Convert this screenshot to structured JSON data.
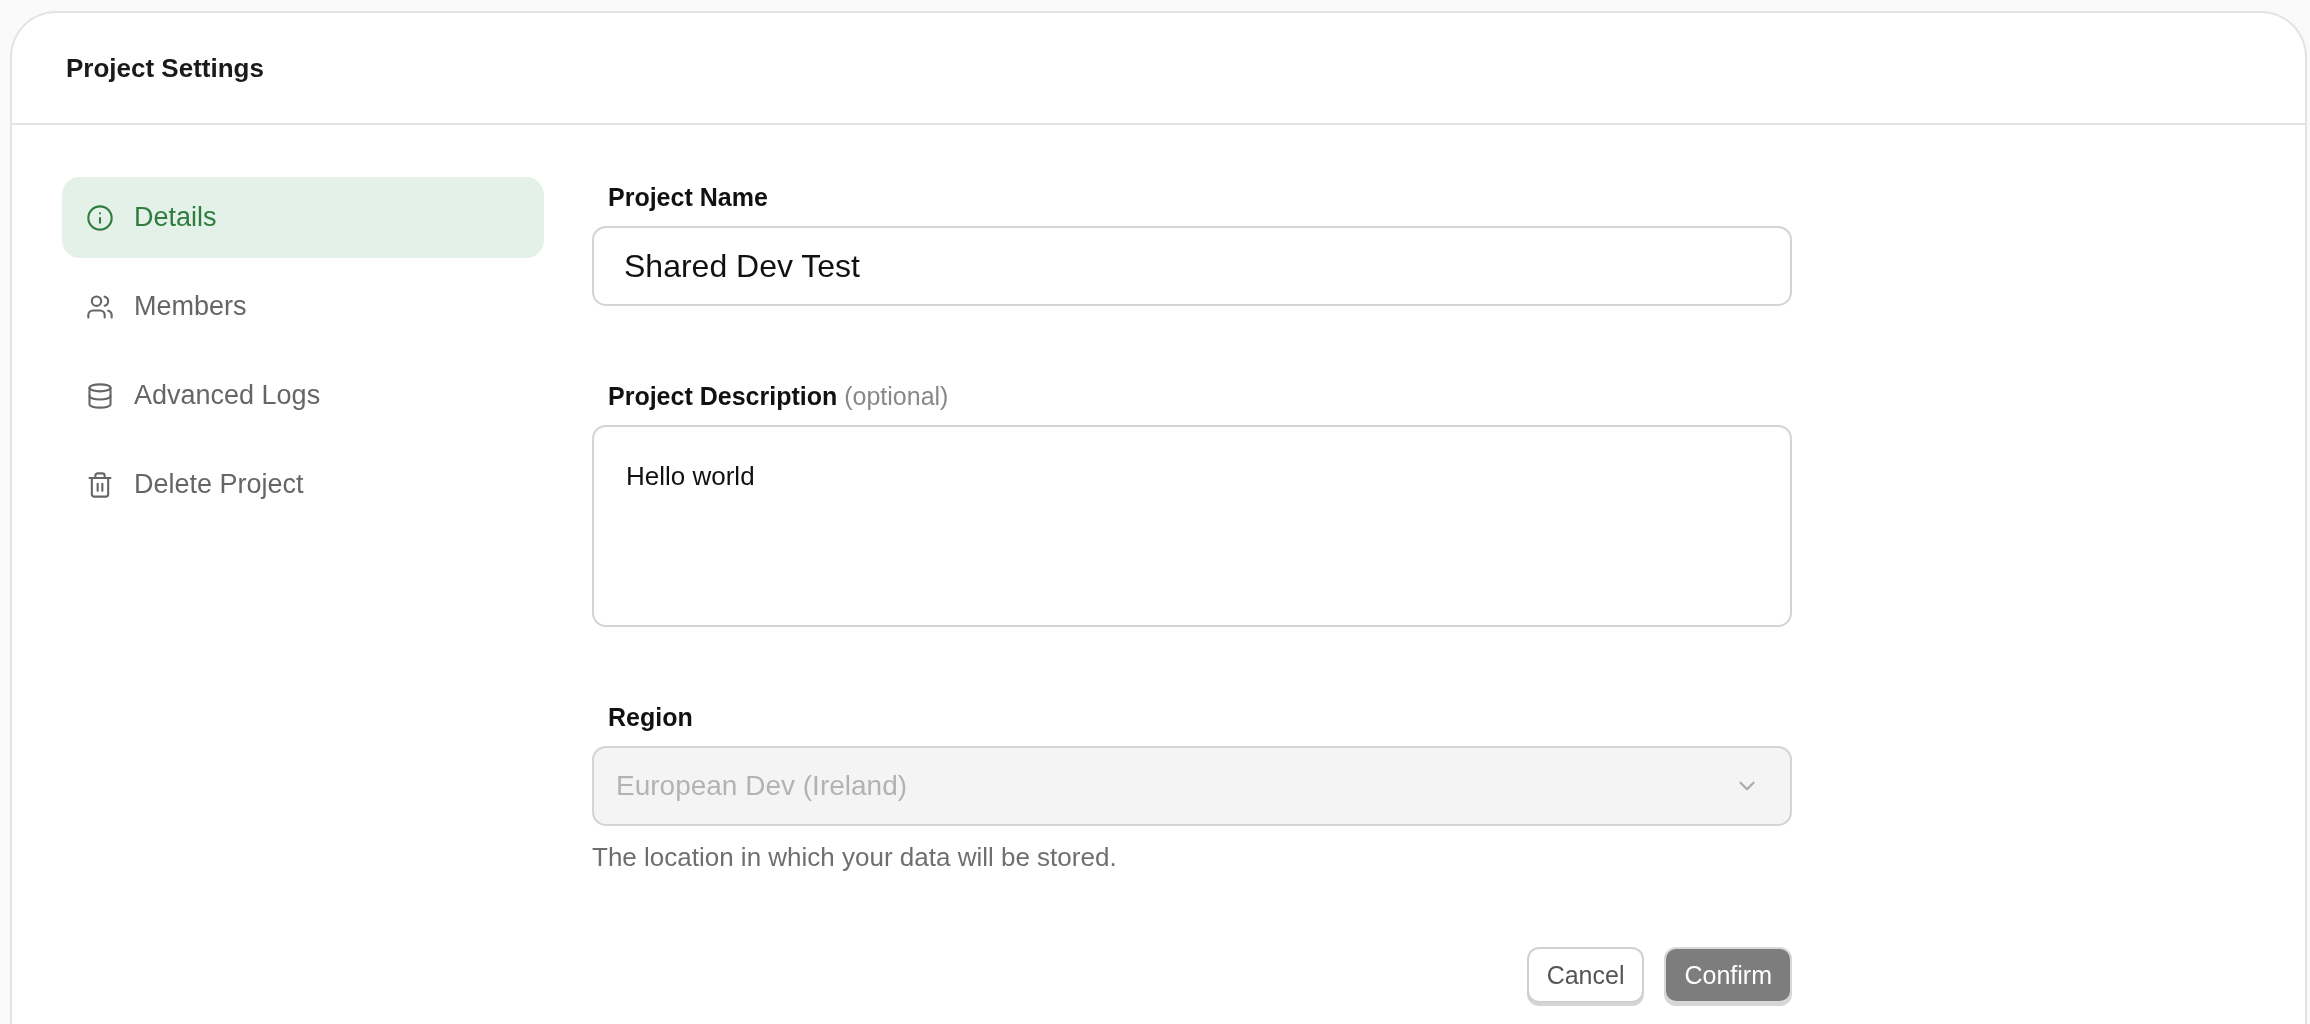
{
  "header": {
    "title": "Project Settings"
  },
  "nav": [
    {
      "label": "Details",
      "kind": "info",
      "selected": true
    },
    {
      "label": "Members",
      "kind": "users",
      "selected": false
    },
    {
      "label": "Advanced Logs",
      "kind": "database",
      "selected": false
    },
    {
      "label": "Delete Project",
      "kind": "trash",
      "selected": false
    }
  ],
  "form": {
    "name": {
      "label": "Project Name",
      "value": "Shared Dev Test"
    },
    "description": {
      "label": "Project Description",
      "hint": "(optional)",
      "value": "Hello world"
    },
    "region": {
      "label": "Region",
      "value": "European Dev (Ireland)",
      "disabled": true,
      "help": "The location in which your data will be stored."
    }
  },
  "buttons": [
    {
      "label": "Cancel",
      "kind": "secondary",
      "disabled": false
    },
    {
      "label": "Confirm",
      "kind": "primary",
      "disabled": true
    }
  ]
}
